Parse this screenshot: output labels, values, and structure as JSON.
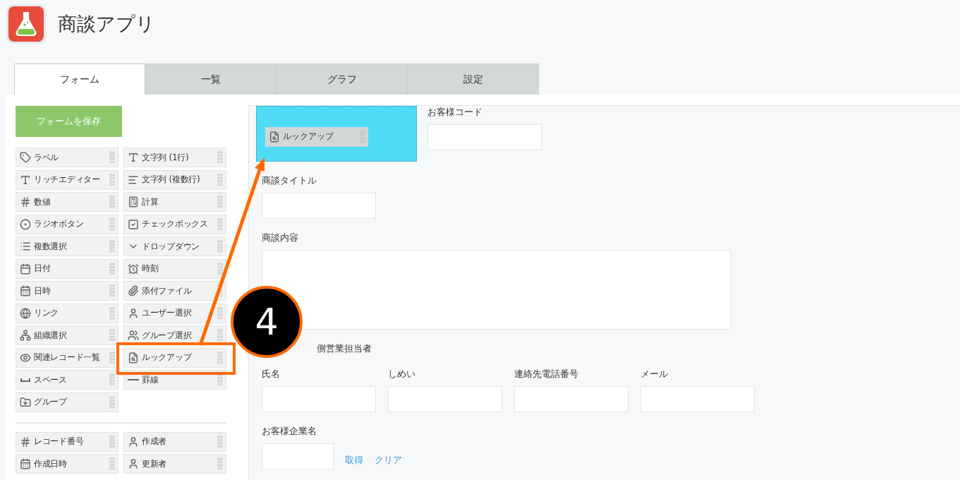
{
  "app": {
    "title": "商談アプリ"
  },
  "tabs": [
    {
      "label": "フォーム",
      "selected": true
    },
    {
      "label": "一覧",
      "selected": false
    },
    {
      "label": "グラフ",
      "selected": false
    },
    {
      "label": "設定",
      "selected": false
    }
  ],
  "palette": {
    "save_button": "フォームを保存",
    "items": [
      {
        "kind": "label",
        "label": "ラベル"
      },
      {
        "kind": "text",
        "label": "文字列 (1行)"
      },
      {
        "kind": "rich",
        "label": "リッチエディター"
      },
      {
        "kind": "multiline",
        "label": "文字列 (複数行)"
      },
      {
        "kind": "number",
        "label": "数値"
      },
      {
        "kind": "calc",
        "label": "計算"
      },
      {
        "kind": "radio",
        "label": "ラジオボタン"
      },
      {
        "kind": "checkbox",
        "label": "チェックボックス"
      },
      {
        "kind": "multiselect",
        "label": "複数選択"
      },
      {
        "kind": "dropdown",
        "label": "ドロップダウン"
      },
      {
        "kind": "date",
        "label": "日付"
      },
      {
        "kind": "time",
        "label": "時刻"
      },
      {
        "kind": "datetime",
        "label": "日時"
      },
      {
        "kind": "attachment",
        "label": "添付ファイル"
      },
      {
        "kind": "link",
        "label": "リンク"
      },
      {
        "kind": "user",
        "label": "ユーザー選択"
      },
      {
        "kind": "org",
        "label": "組織選択"
      },
      {
        "kind": "groupselect",
        "label": "グループ選択"
      },
      {
        "kind": "related",
        "label": "関連レコード一覧"
      },
      {
        "kind": "lookup",
        "label": "ルックアップ"
      },
      {
        "kind": "space",
        "label": "スペース"
      },
      {
        "kind": "rule",
        "label": "罫線"
      },
      {
        "kind": "group",
        "label": "グループ"
      }
    ],
    "system_items": [
      {
        "kind": "number",
        "label": "レコード番号"
      },
      {
        "kind": "user",
        "label": "作成者"
      },
      {
        "kind": "datetime",
        "label": "作成日時"
      },
      {
        "kind": "user",
        "label": "更新者"
      }
    ]
  },
  "form": {
    "rows": [
      {
        "cells": [
          {
            "kind": "dropzone",
            "label": "ルックアップ"
          },
          {
            "kind": "text",
            "label": "お客様コード"
          }
        ]
      },
      {
        "cells": [
          {
            "kind": "text",
            "label": "商談タイトル"
          }
        ]
      },
      {
        "cells": [
          {
            "kind": "textarea",
            "label": "商談内容"
          }
        ]
      },
      {
        "cells": [
          {
            "kind": "heading",
            "label": "側営業担当者"
          }
        ]
      },
      {
        "cells": [
          {
            "kind": "text",
            "label": "氏名"
          },
          {
            "kind": "text",
            "label": "しめい"
          },
          {
            "kind": "text",
            "label": "連絡先電話番号"
          },
          {
            "kind": "text",
            "label": "メール"
          }
        ]
      },
      {
        "cells": [
          {
            "kind": "lookup",
            "label": "お客様企業名",
            "actions": [
              "取得",
              "クリア"
            ]
          }
        ]
      }
    ]
  },
  "annotation": {
    "step": "4"
  }
}
